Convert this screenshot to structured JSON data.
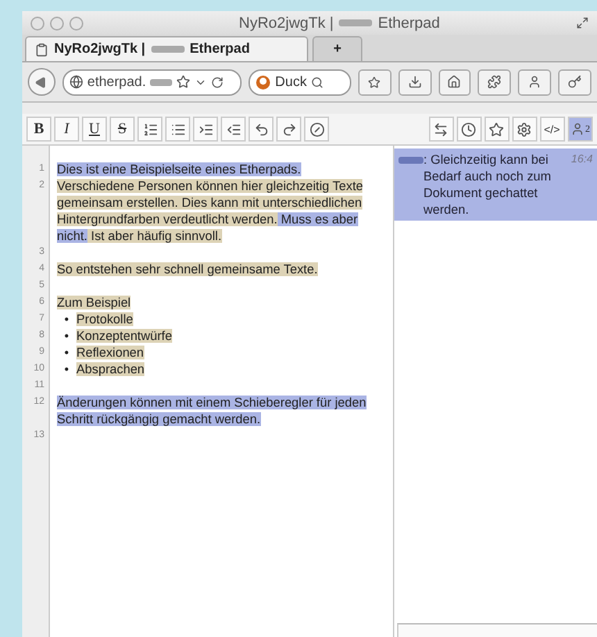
{
  "window": {
    "title_start": "NyRo2jwgTk |",
    "title_end": "Etherpad"
  },
  "tabs": [
    {
      "label_start": "NyRo2jwgTk |",
      "label_end": "Etherpad",
      "selected": true
    },
    {
      "label": "+",
      "selected": false
    }
  ],
  "navigation": {
    "address": "etherpad.",
    "search": "Duck"
  },
  "editor_toolbar": {
    "format_buttons": [
      "B",
      "I",
      "U",
      "S"
    ],
    "embed_button": "</>",
    "user_count": "2"
  },
  "lines": [
    {
      "number": "1",
      "kind": "text",
      "segments": [
        {
          "text": "Dies ist eine Beispielseite eines Etherpads.",
          "color": "#aab4e4"
        }
      ]
    },
    {
      "number": "2",
      "kind": "text",
      "segments": [
        {
          "text": "Verschiedene Personen können hier gleichzeitig Texte gemeinsam erstellen. Dies kann mit unterschiedlichen Hintergrundfarben verdeutlicht werden.",
          "color": "#ddd3b6"
        },
        {
          "text": " Muss es aber nicht.",
          "color": "#aab4e4"
        },
        {
          "text": " Ist aber häufig sinnvoll.",
          "color": "#ddd3b6"
        }
      ]
    },
    {
      "number": "3",
      "kind": "text"
    },
    {
      "number": "4",
      "kind": "text",
      "segments": [
        {
          "text": "So entstehen sehr schnell gemeinsame Texte.",
          "color": "#ddd3b6"
        }
      ]
    },
    {
      "number": "5",
      "kind": "text"
    },
    {
      "number": "6",
      "kind": "text",
      "segments": [
        {
          "text": "Zum Beispiel",
          "color": "#ddd3b6"
        }
      ]
    },
    {
      "number": "7",
      "kind": "bullet",
      "marker": "•",
      "segments": [
        {
          "text": "Protokolle",
          "color": "#ddd3b6"
        }
      ]
    },
    {
      "number": "8",
      "kind": "bullet",
      "marker": "•",
      "segments": [
        {
          "text": "Konzeptentwürfe",
          "color": "#ddd3b6"
        }
      ]
    },
    {
      "number": "9",
      "kind": "bullet",
      "marker": "•",
      "segments": [
        {
          "text": "Reflexionen",
          "color": "#ddd3b6"
        }
      ]
    },
    {
      "number": "10",
      "kind": "bullet",
      "marker": "•",
      "segments": [
        {
          "text": "Absprachen",
          "color": "#ddd3b6"
        }
      ]
    },
    {
      "number": "11",
      "kind": "text"
    },
    {
      "number": "12",
      "kind": "text",
      "segments": [
        {
          "text": "Änderungen können mit einem Schieberegler für jeden Schritt rückgängig gemacht werden.",
          "color": "#aab4e4"
        }
      ]
    },
    {
      "number": "13",
      "kind": "text"
    }
  ],
  "chat": {
    "messages": [
      {
        "text": ": Gleichzeitig kann bei Bedarf auch noch zum Dokument gechattet werden.",
        "time": "16:4",
        "color": "#aab4e4"
      }
    ]
  }
}
